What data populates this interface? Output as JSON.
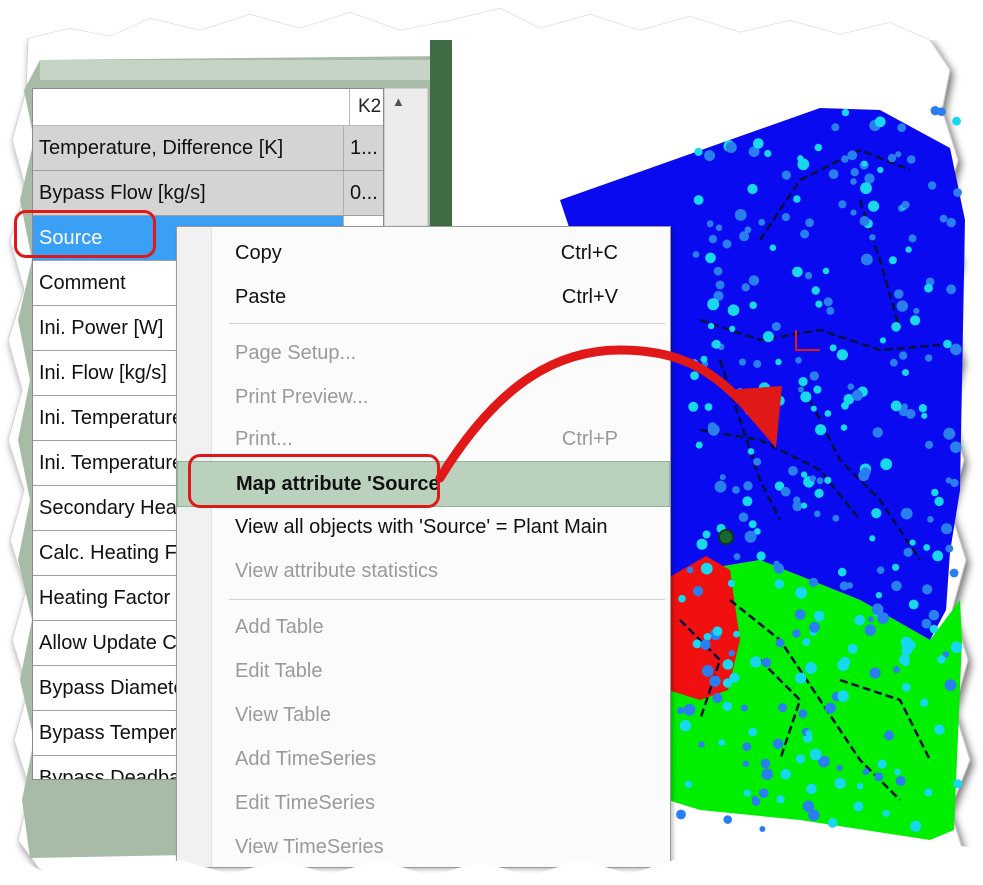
{
  "grid": {
    "header_value": "K2!",
    "rows": [
      {
        "label": "Temperature, Difference [K]",
        "value": "1..."
      },
      {
        "label": "Bypass Flow [kg/s]",
        "value": "0..."
      },
      {
        "label": "Source",
        "value": ""
      },
      {
        "label": "Comment",
        "value": ""
      },
      {
        "label": "Ini. Power [W]",
        "value": ""
      },
      {
        "label": "Ini. Flow [kg/s]",
        "value": ""
      },
      {
        "label": "Ini. Temperature,",
        "value": ""
      },
      {
        "label": "Ini. Temperature,",
        "value": ""
      },
      {
        "label": "Secondary Heat I",
        "value": ""
      },
      {
        "label": "Calc. Heating Fac",
        "value": ""
      },
      {
        "label": "Heating Factor",
        "value": ""
      },
      {
        "label": "Allow Update Cor",
        "value": ""
      },
      {
        "label": "Bypass Diameter",
        "value": ""
      },
      {
        "label": "Bypass Temperat",
        "value": ""
      },
      {
        "label": "Bypass Deadban",
        "value": ""
      }
    ]
  },
  "context_menu": {
    "copy": {
      "label": "Copy",
      "shortcut": "Ctrl+C"
    },
    "paste": {
      "label": "Paste",
      "shortcut": "Ctrl+V"
    },
    "page_setup": {
      "label": "Page Setup..."
    },
    "print_preview": {
      "label": "Print Preview..."
    },
    "print": {
      "label": "Print...",
      "shortcut": "Ctrl+P"
    },
    "map_attribute": {
      "label": "Map attribute 'Source'"
    },
    "view_all": {
      "label": "View all objects with 'Source' = Plant Main"
    },
    "view_stats": {
      "label": "View attribute statistics"
    },
    "add_table": {
      "label": "Add Table"
    },
    "edit_table": {
      "label": "Edit Table"
    },
    "view_table": {
      "label": "View Table"
    },
    "add_timeseries": {
      "label": "Add TimeSeries"
    },
    "edit_timeseries": {
      "label": "Edit TimeSeries"
    },
    "view_timeseries": {
      "label": "View TimeSeries"
    }
  },
  "colors": {
    "zone_blue": "#0a0af0",
    "zone_green": "#00ee00",
    "zone_red": "#f01010",
    "node_cyan": "#18d8f0",
    "node_blue": "#2a7ff0",
    "highlight_green": "#b9d1bd",
    "callout_red": "#e01818",
    "selected_blue": "#3aa0f5"
  }
}
